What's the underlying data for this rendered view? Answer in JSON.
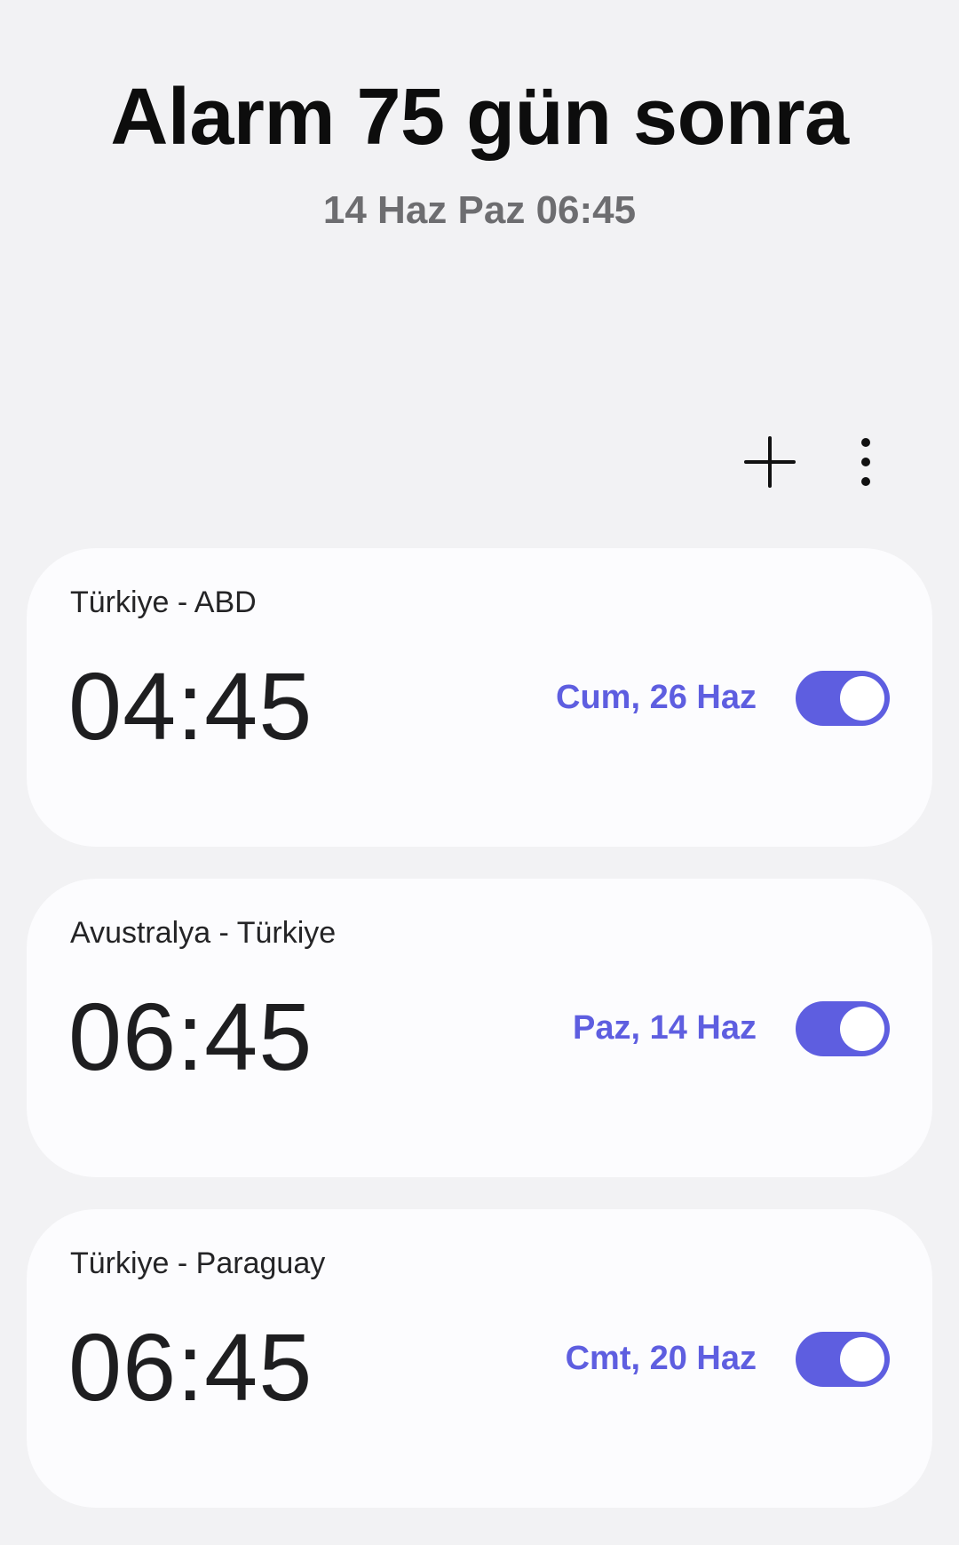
{
  "header": {
    "title": "Alarm 75 gün sonra",
    "subtitle": "14 Haz Paz 06:45"
  },
  "toolbar": {
    "add_icon": "plus-icon",
    "more_icon": "more-vertical-icon"
  },
  "alarms": [
    {
      "label": "Türkiye - ABD",
      "time": "04:45",
      "date": "Cum, 26 Haz",
      "enabled": true
    },
    {
      "label": "Avustralya - Türkiye",
      "time": "06:45",
      "date": "Paz, 14 Haz",
      "enabled": true
    },
    {
      "label": "Türkiye - Paraguay",
      "time": "06:45",
      "date": "Cmt, 20 Haz",
      "enabled": true
    }
  ],
  "colors": {
    "accent": "#5e5ee0",
    "background": "#f2f2f4",
    "card": "#fcfcfe"
  }
}
